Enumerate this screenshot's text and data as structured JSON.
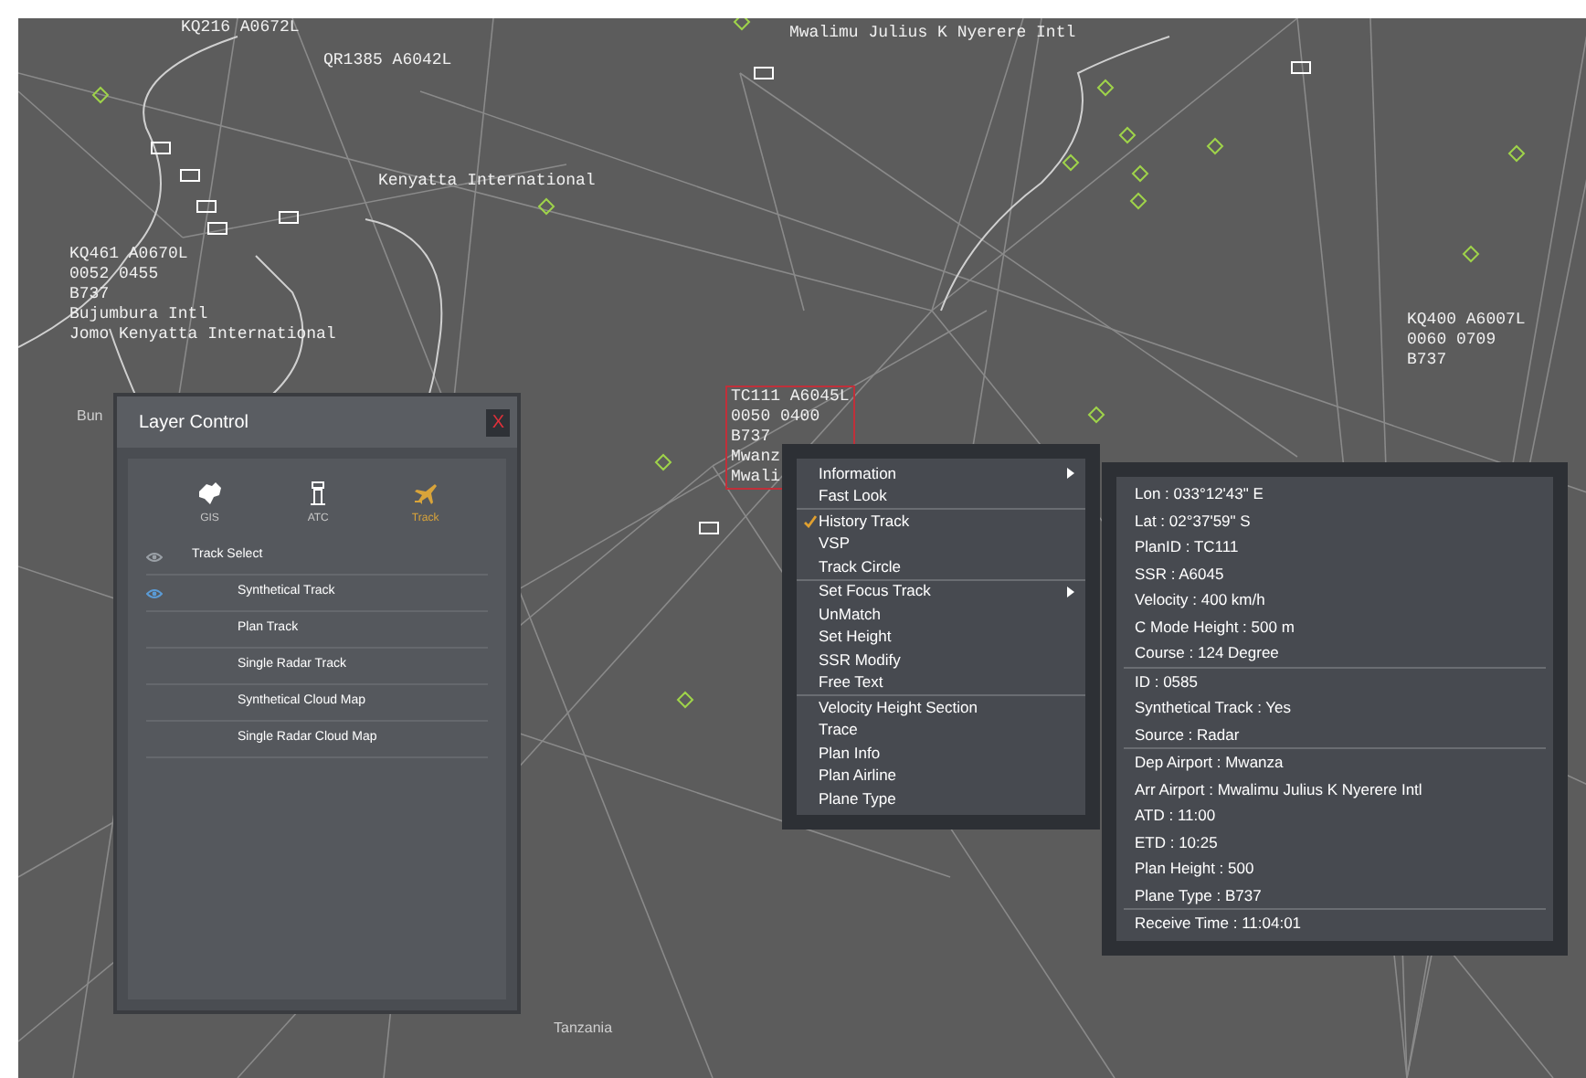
{
  "map_labels": [
    {
      "lines": [
        "KQ216 A0672L"
      ],
      "highlighted": false
    },
    {
      "lines": [
        "QR1385 A6042L"
      ],
      "highlighted": false
    },
    {
      "lines": [
        "Kenyatta International"
      ],
      "highlighted": false
    },
    {
      "lines": [
        "KQ461 A0670L",
        "0052 0455",
        "B737",
        "Bujumbura Intl",
        "Jomo Kenyatta International"
      ],
      "highlighted": false
    },
    {
      "lines": [
        "Mwalimu Julius K Nyerere Intl"
      ],
      "highlighted": false
    },
    {
      "lines": [
        "KQ400 A6007L",
        "0060 0709",
        "B737"
      ],
      "highlighted": false
    },
    {
      "lines": [
        "TC111 A6045L",
        "0050 0400",
        "B737",
        "Mwanz",
        "Mwali"
      ],
      "highlighted": true
    }
  ],
  "place_names": [
    "Bun",
    "Tanzania"
  ],
  "layer_control": {
    "title": "Layer Control",
    "close": "X",
    "tabs": [
      {
        "label": "GIS",
        "kind": "gis",
        "selected": false
      },
      {
        "label": "ATC",
        "kind": "atc",
        "selected": false
      },
      {
        "label": "Track",
        "kind": "track",
        "selected": true
      }
    ],
    "tree": [
      {
        "label": "Track Select",
        "visible": false,
        "children": [
          {
            "label": "Synthetical Track",
            "visible": true
          },
          {
            "label": "Plan Track",
            "visible": false
          },
          {
            "label": "Single Radar Track",
            "visible": false
          },
          {
            "label": "Synthetical Cloud Map",
            "visible": false
          },
          {
            "label": "Single Radar Cloud Map",
            "visible": false
          }
        ]
      }
    ]
  },
  "context_menu": {
    "groups": [
      [
        {
          "label": "Information",
          "checked": false,
          "submenu": true
        },
        {
          "label": "Fast Look",
          "checked": false,
          "submenu": false
        }
      ],
      [
        {
          "label": "History Track",
          "checked": true,
          "submenu": false
        },
        {
          "label": "VSP",
          "checked": false,
          "submenu": false
        },
        {
          "label": "Track Circle",
          "checked": false,
          "submenu": false
        }
      ],
      [
        {
          "label": "Set Focus Track",
          "checked": false,
          "submenu": true
        },
        {
          "label": "UnMatch",
          "checked": false,
          "submenu": false
        },
        {
          "label": "Set Height",
          "checked": false,
          "submenu": false
        },
        {
          "label": "SSR Modify",
          "checked": false,
          "submenu": false
        },
        {
          "label": "Free Text",
          "checked": false,
          "submenu": false
        }
      ],
      [
        {
          "label": "Velocity Height Section",
          "checked": false,
          "submenu": false
        },
        {
          "label": "Trace",
          "checked": false,
          "submenu": false
        },
        {
          "label": "Plan Info",
          "checked": false,
          "submenu": false
        },
        {
          "label": "Plan Airline",
          "checked": false,
          "submenu": false
        },
        {
          "label": "Plane Type",
          "checked": false,
          "submenu": false
        }
      ]
    ]
  },
  "info_panel": {
    "groups": [
      [
        "Lon : 033°12'43\" E",
        "Lat :  02°37'59\" S",
        "PlanID : TC111",
        "SSR : A6045",
        "Velocity : 400 km/h",
        "C Mode Height : 500 m",
        "Course : 124 Degree"
      ],
      [
        "ID : 0585",
        "Synthetical Track : Yes",
        "Source : Radar"
      ],
      [
        "Dep Airport : Mwanza",
        "Arr Airport : Mwalimu Julius K Nyerere Intl",
        "ATD : 11:00",
        "ETD : 10:25",
        "Plan Height : 500",
        "Plane Type : B737"
      ],
      [
        "Receive Time : 11:04:01"
      ]
    ]
  }
}
